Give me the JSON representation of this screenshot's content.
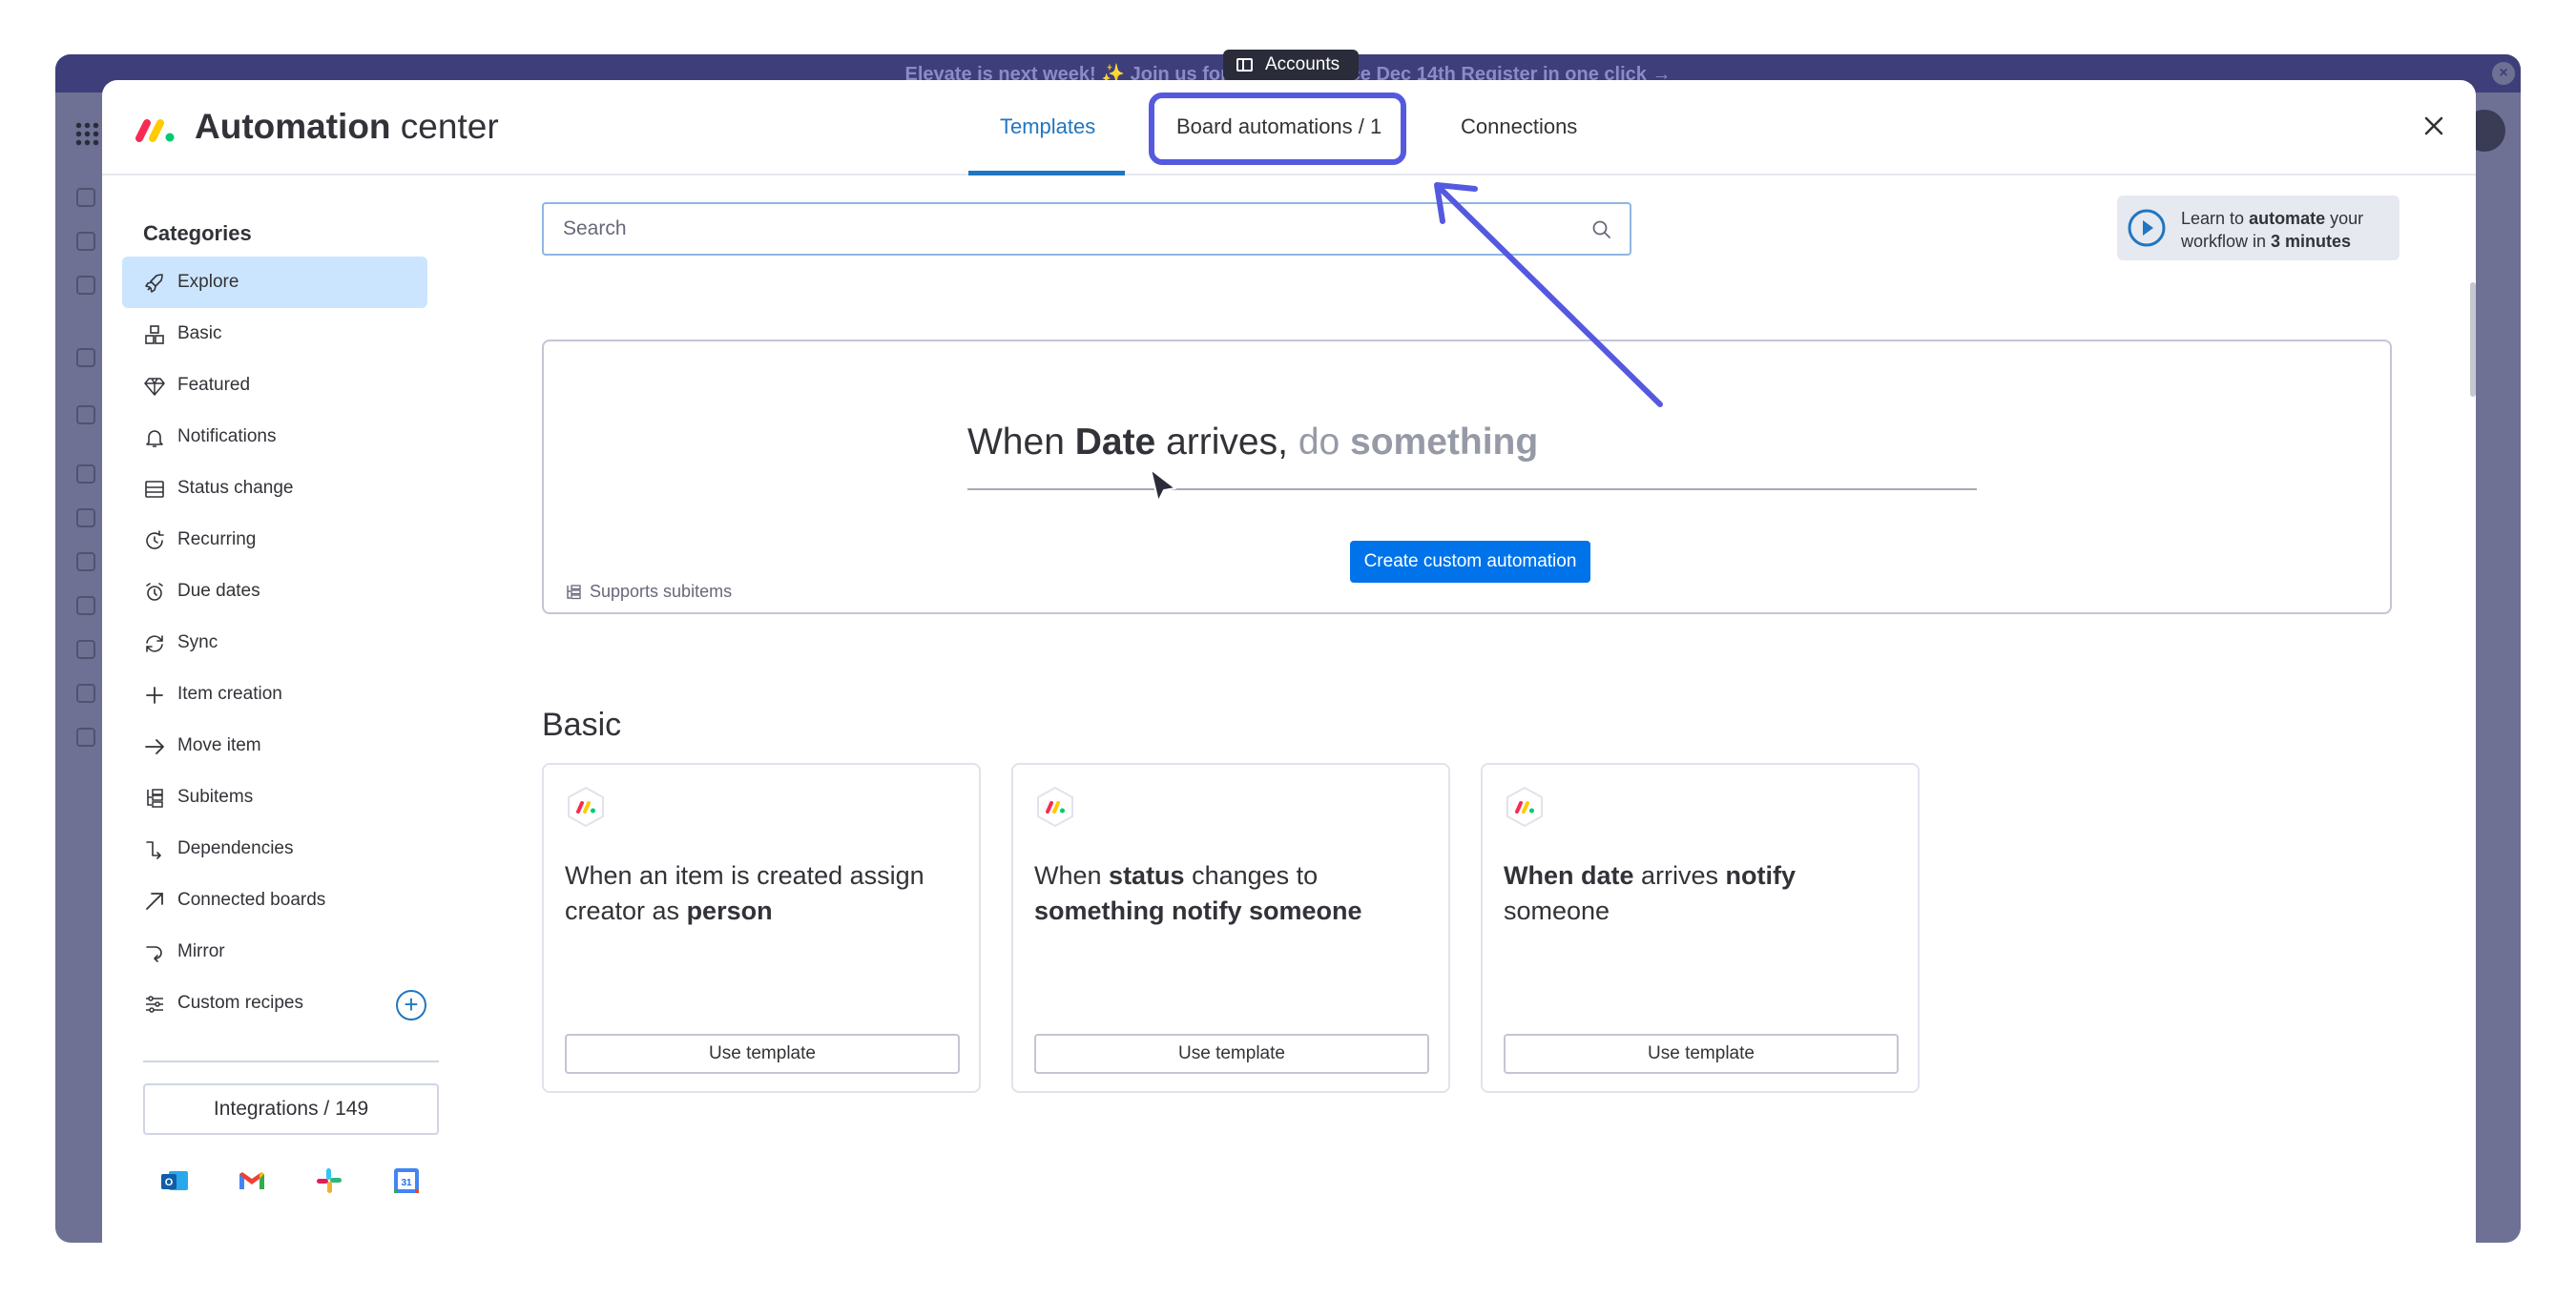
{
  "banner": {
    "text": "Elevate is next week! ✨ Join us for our conference Dec 14th    Register in one click →"
  },
  "accounts_tab": {
    "label": "Accounts"
  },
  "header": {
    "title_bold": "Automation",
    "title_light": " center",
    "tabs": [
      {
        "label": "Templates",
        "active": true
      },
      {
        "label": "Board automations / 1",
        "active": false
      },
      {
        "label": "Connections",
        "active": false
      }
    ]
  },
  "sidebar": {
    "title": "Categories",
    "items": [
      {
        "label": "Explore",
        "icon": "rocket-icon",
        "active": true
      },
      {
        "label": "Basic",
        "icon": "boxes-icon"
      },
      {
        "label": "Featured",
        "icon": "diamond-icon"
      },
      {
        "label": "Notifications",
        "icon": "bell-icon"
      },
      {
        "label": "Status change",
        "icon": "status-icon"
      },
      {
        "label": "Recurring",
        "icon": "recurring-icon"
      },
      {
        "label": "Due dates",
        "icon": "alarm-icon"
      },
      {
        "label": "Sync",
        "icon": "sync-icon"
      },
      {
        "label": "Item creation",
        "icon": "plus-icon"
      },
      {
        "label": "Move item",
        "icon": "arrow-right-icon"
      },
      {
        "label": "Subitems",
        "icon": "subitems-icon"
      },
      {
        "label": "Dependencies",
        "icon": "dependencies-icon"
      },
      {
        "label": "Connected boards",
        "icon": "arrow-diagonal-icon"
      },
      {
        "label": "Mirror",
        "icon": "mirror-icon"
      },
      {
        "label": "Custom recipes",
        "icon": "sliders-icon"
      }
    ],
    "integrations_label": "Integrations / 149",
    "integrations": [
      "outlook-icon",
      "gmail-icon",
      "slack-icon",
      "google-calendar-icon"
    ]
  },
  "search": {
    "placeholder": "Search",
    "value": ""
  },
  "learn": {
    "prefix": "Learn to ",
    "bold1": "automate",
    "mid": " your workflow in ",
    "bold2": "3 minutes"
  },
  "custom_card": {
    "w1": "When ",
    "w2": "Date",
    "w3": " arrives,",
    "w4": "do ",
    "w5": "something",
    "create_button": "Create custom automation",
    "supports": "Supports subitems"
  },
  "basic_section": {
    "title": "Basic",
    "cards": [
      {
        "parts": [
          "When an item is created assign creator as ",
          "person",
          ""
        ],
        "button": "Use template"
      },
      {
        "parts": [
          "When ",
          "status",
          " changes to "
        ],
        "parts2": [
          "",
          "something notify someone",
          ""
        ],
        "button": "Use template"
      },
      {
        "parts": [
          "",
          "When date",
          " arrives "
        ],
        "parts2": [
          "",
          "notify",
          " someone"
        ],
        "button": "Use template"
      }
    ]
  },
  "colors": {
    "accent": "#1f76c2",
    "primary_button": "#0073ea",
    "highlight": "#5559df",
    "active_bg": "#cce5ff"
  }
}
